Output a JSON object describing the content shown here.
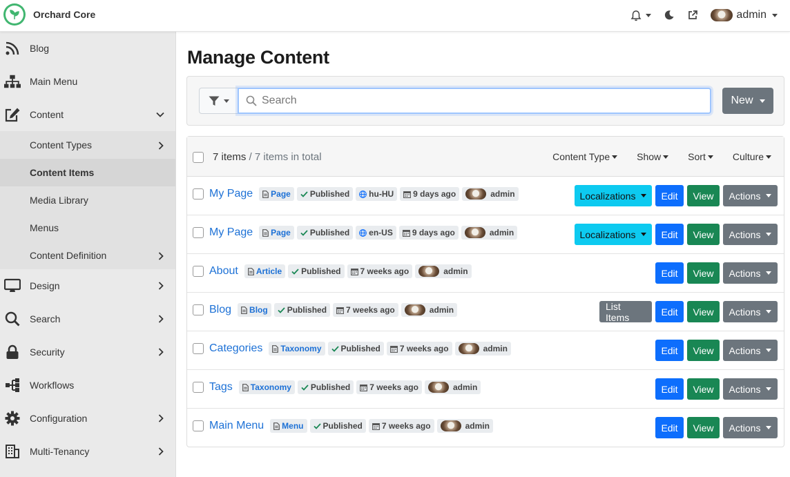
{
  "brand": {
    "name": "Orchard Core"
  },
  "topbar": {
    "user": "admin"
  },
  "sidebar": {
    "items": [
      {
        "label": "Blog",
        "icon": "rss-icon",
        "chevron": false
      },
      {
        "label": "Main Menu",
        "icon": "sitemap-icon",
        "chevron": false
      },
      {
        "label": "Content",
        "icon": "edit-icon",
        "chevron": "down"
      },
      {
        "label": "Design",
        "icon": "desktop-icon",
        "chevron": "right"
      },
      {
        "label": "Search",
        "icon": "search-icon",
        "chevron": "right"
      },
      {
        "label": "Security",
        "icon": "lock-icon",
        "chevron": "right"
      },
      {
        "label": "Workflows",
        "icon": "workflow-icon",
        "chevron": false
      },
      {
        "label": "Configuration",
        "icon": "gear-icon",
        "chevron": "right"
      },
      {
        "label": "Multi-Tenancy",
        "icon": "building-icon",
        "chevron": "right"
      }
    ],
    "content_sub": [
      {
        "label": "Content Types",
        "chevron": true,
        "active": false
      },
      {
        "label": "Content Items",
        "chevron": false,
        "active": true
      },
      {
        "label": "Media Library",
        "chevron": false,
        "active": false
      },
      {
        "label": "Menus",
        "chevron": false,
        "active": false
      },
      {
        "label": "Content Definition",
        "chevron": true,
        "active": false
      }
    ]
  },
  "page": {
    "title": "Manage Content"
  },
  "search": {
    "placeholder": "Search",
    "value": "",
    "new_label": "New"
  },
  "list": {
    "count": "7 items",
    "total": "/ 7 items in total",
    "filters": [
      "Content Type",
      "Show",
      "Sort",
      "Culture"
    ],
    "rows": [
      {
        "title": "My Page",
        "type": "Page",
        "status": "Published",
        "culture": "hu-HU",
        "modified": "9 days ago",
        "owner": "admin",
        "localizations": "Localizations",
        "list_items": ""
      },
      {
        "title": "My Page",
        "type": "Page",
        "status": "Published",
        "culture": "en-US",
        "modified": "9 days ago",
        "owner": "admin",
        "localizations": "Localizations",
        "list_items": ""
      },
      {
        "title": "About",
        "type": "Article",
        "status": "Published",
        "culture": "",
        "modified": "7 weeks ago",
        "owner": "admin",
        "localizations": "",
        "list_items": ""
      },
      {
        "title": "Blog",
        "type": "Blog",
        "status": "Published",
        "culture": "",
        "modified": "7 weeks ago",
        "owner": "admin",
        "localizations": "",
        "list_items": "List Items"
      },
      {
        "title": "Categories",
        "type": "Taxonomy",
        "status": "Published",
        "culture": "",
        "modified": "7 weeks ago",
        "owner": "admin",
        "localizations": "",
        "list_items": ""
      },
      {
        "title": "Tags",
        "type": "Taxonomy",
        "status": "Published",
        "culture": "",
        "modified": "7 weeks ago",
        "owner": "admin",
        "localizations": "",
        "list_items": ""
      },
      {
        "title": "Main Menu",
        "type": "Menu",
        "status": "Published",
        "culture": "",
        "modified": "7 weeks ago",
        "owner": "admin",
        "localizations": "",
        "list_items": ""
      }
    ],
    "edit_label": "Edit",
    "view_label": "View",
    "actions_label": "Actions"
  },
  "colors": {
    "brand": "#41b670",
    "primary": "#0d6efd",
    "success": "#198754",
    "info": "#0dcaf0",
    "secondary": "#6c757d",
    "link": "#1d71d6"
  }
}
